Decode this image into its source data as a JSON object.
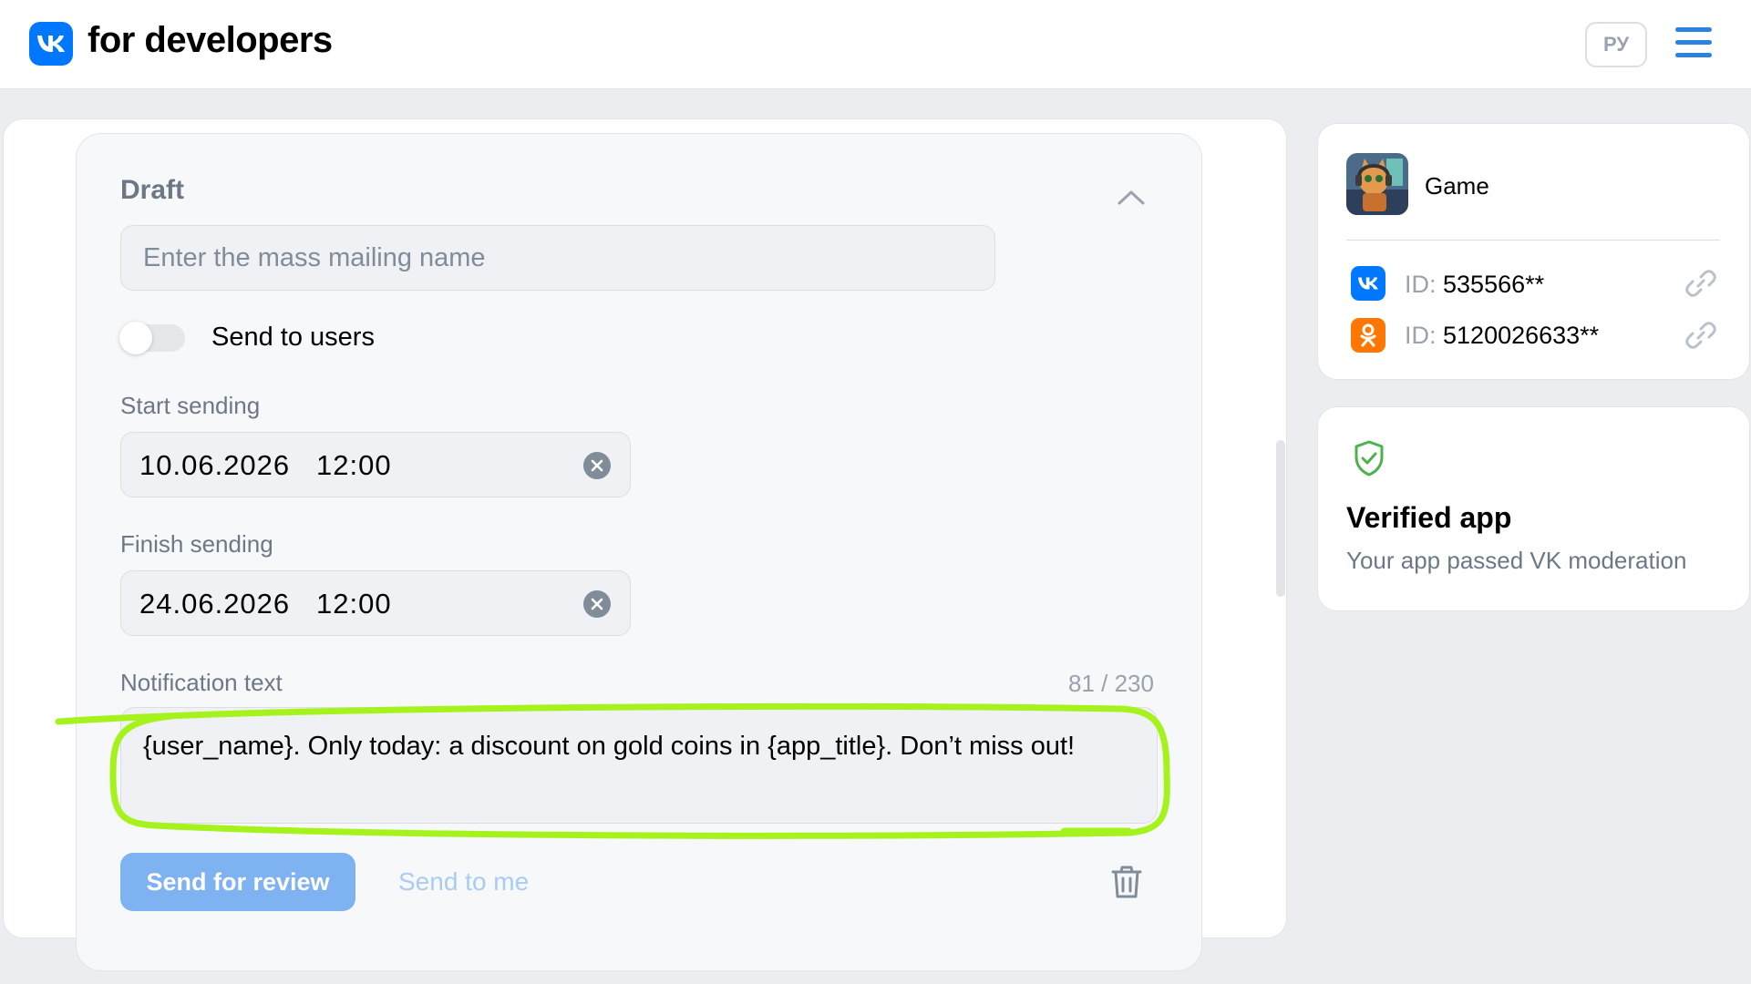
{
  "header": {
    "brand": "for developers",
    "lang_button": "РУ"
  },
  "draft": {
    "title": "Draft",
    "name_placeholder": "Enter the mass mailing name",
    "toggle_label": "Send to users",
    "toggle_on": false,
    "start_label": "Start sending",
    "start_value": "10.06.2026   12:00",
    "finish_label": "Finish sending",
    "finish_value": "24.06.2026   12:00",
    "notification_label": "Notification text",
    "counter": "81 / 230",
    "notification_text": "{user_name}. Only today: a discount on gold coins in {app_title}. Don’t miss out!",
    "review_button": "Send for review",
    "send_me_button": "Send to me"
  },
  "app_card": {
    "name": "Game",
    "ids": [
      {
        "icon": "vk-icon",
        "prefix": "ID: ",
        "value": "535566**"
      },
      {
        "icon": "ok-icon",
        "prefix": "ID: ",
        "value": "5120026633**"
      }
    ]
  },
  "verified": {
    "title": "Verified app",
    "subtitle": "Your app passed VK moderation"
  },
  "colors": {
    "accent": "#0077ff",
    "ok_orange": "#ff7700",
    "highlight": "#a6f21c",
    "verified_green": "#4bb34b"
  }
}
